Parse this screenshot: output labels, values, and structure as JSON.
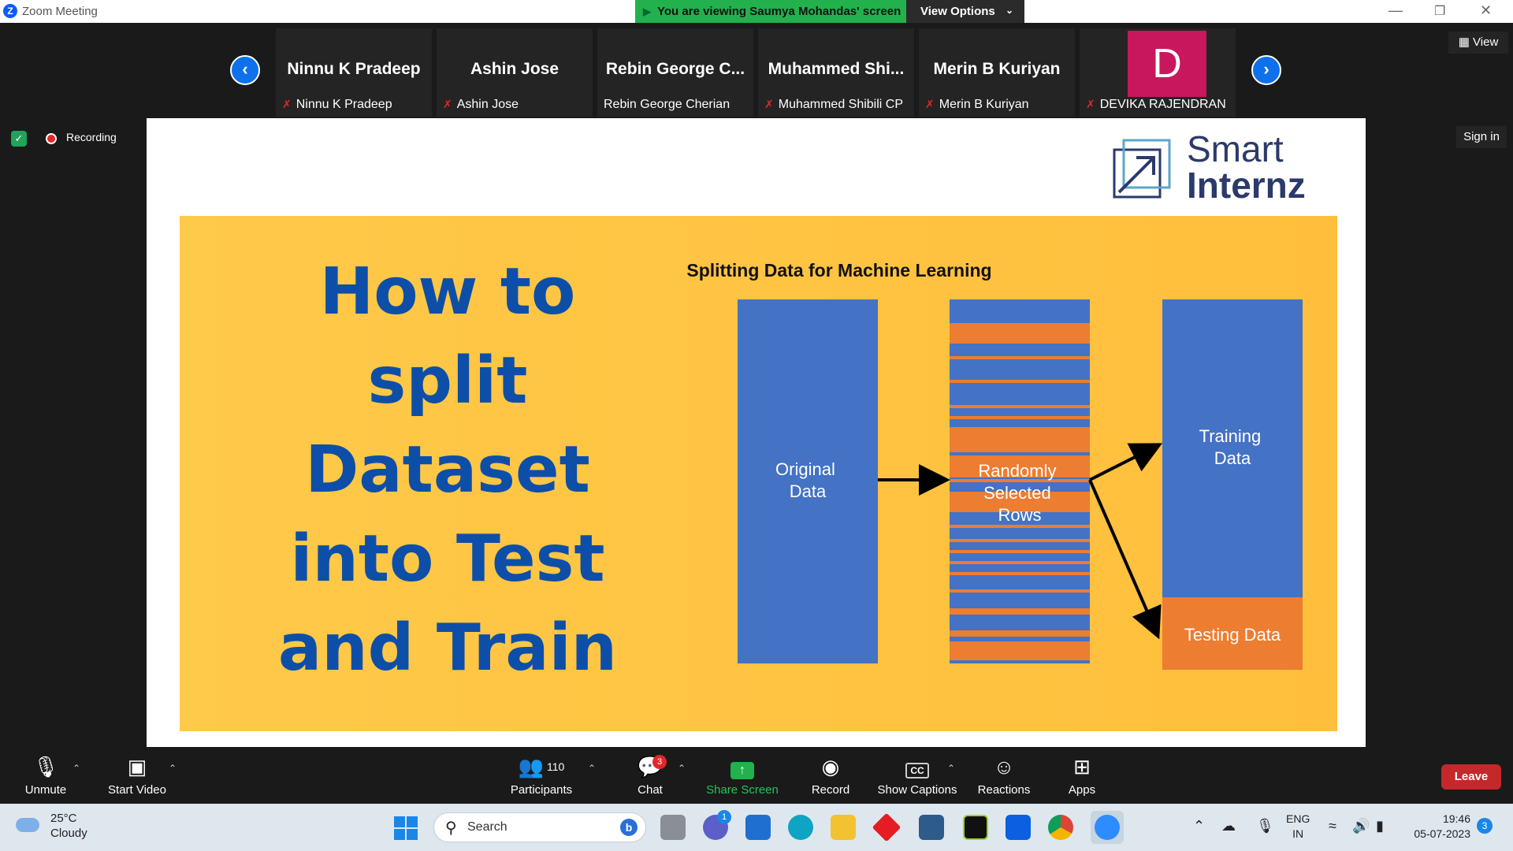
{
  "window": {
    "title": "Zoom Meeting",
    "viewing_banner": "You are viewing Saumya Mohandas' screen",
    "view_options": "View Options"
  },
  "participants": [
    {
      "tile_name": "Ninnu K Pradeep",
      "label": "Ninnu K Pradeep",
      "muted": true
    },
    {
      "tile_name": "Ashin Jose",
      "label": "Ashin Jose",
      "muted": true
    },
    {
      "tile_name": "Rebin George C...",
      "label": "Rebin George Cherian",
      "muted": false
    },
    {
      "tile_name": "Muhammed Shi...",
      "label": "Muhammed Shibili CP",
      "muted": true
    },
    {
      "tile_name": "Merin B Kuriyan",
      "label": "Merin B Kuriyan",
      "muted": true
    },
    {
      "avatar_letter": "D",
      "label": "DEVIKA RAJENDRAN",
      "muted": true
    }
  ],
  "view_button": "View",
  "sign_in": "Sign in",
  "recording": "Recording",
  "slide": {
    "logo_line1": "Smart",
    "logo_line2": "Internz",
    "headline": [
      "How to",
      "split",
      "Dataset",
      "into Test",
      "and Train"
    ],
    "diagram_title": "Splitting Data for Machine Learning",
    "box1": [
      "Original",
      "Data"
    ],
    "box2": [
      "Randomly",
      "Selected",
      "Rows"
    ],
    "box3": [
      "Training",
      "Data"
    ],
    "box3_bottom": "Testing Data",
    "colors": {
      "blue": "#4472c4",
      "orange": "#ed7d31",
      "background": "#ffc34a",
      "headline": "#0d4fa8"
    }
  },
  "toolbar": {
    "unmute": "Unmute",
    "start_video": "Start Video",
    "participants": "Participants",
    "participant_count": "110",
    "chat": "Chat",
    "chat_badge": "3",
    "share_screen": "Share Screen",
    "record": "Record",
    "show_captions": "Show Captions",
    "reactions": "Reactions",
    "apps": "Apps",
    "leave": "Leave"
  },
  "taskbar": {
    "weather_temp": "25°C",
    "weather_desc": "Cloudy",
    "search": "Search",
    "lang1": "ENG",
    "lang2": "IN",
    "time": "19:46",
    "date": "05-07-2023",
    "notifications": "3",
    "teams_badge": "1"
  }
}
